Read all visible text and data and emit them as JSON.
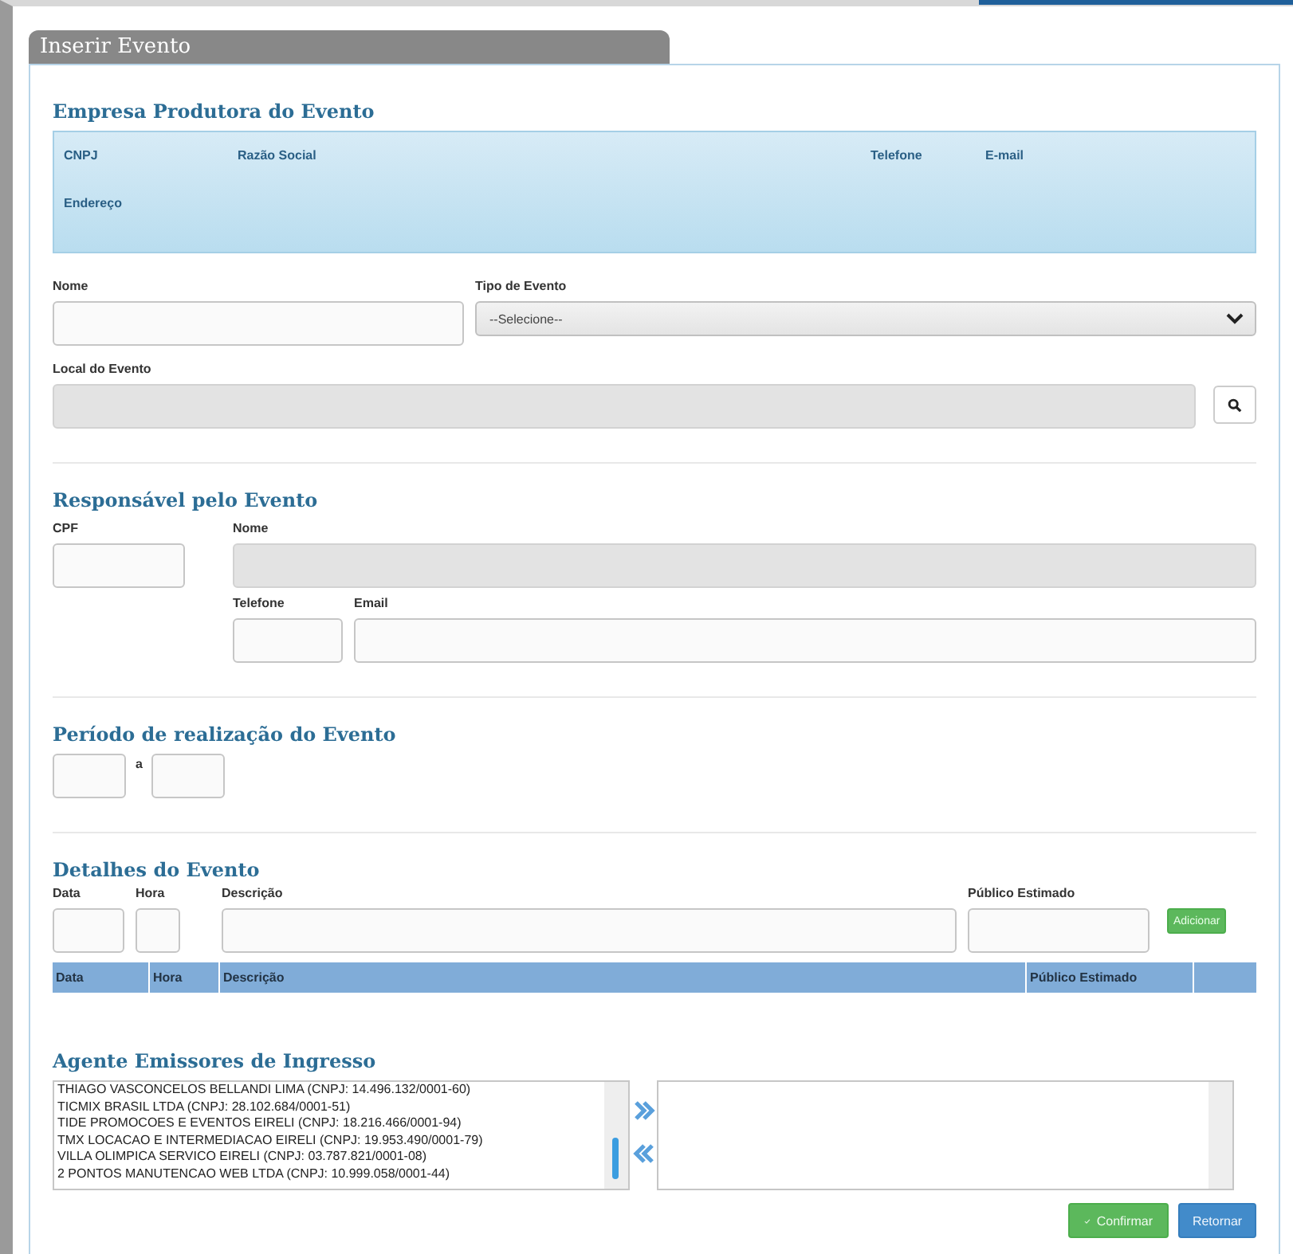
{
  "window": {
    "title": "Inserir Evento"
  },
  "company": {
    "heading": "Empresa Produtora do Evento",
    "labels": [
      "CNPJ",
      "Razão Social",
      "Telefone",
      "E-mail"
    ],
    "address_label": "Endereço"
  },
  "event": {
    "name": {
      "label": "Nome",
      "disabled": false
    },
    "type": {
      "label": "Tipo de Evento",
      "value": "--Selecione--"
    },
    "location": {
      "label": "Local do Evento",
      "disabled": true
    }
  },
  "responsible": {
    "heading": "Responsável pelo Evento",
    "fields": [
      {
        "label": "CPF",
        "disabled": false
      },
      {
        "label": "Nome",
        "disabled": true
      },
      {
        "label": "Telefone",
        "disabled": false
      },
      {
        "label": "Email",
        "disabled": false
      }
    ]
  },
  "period": {
    "heading": "Período de realização do Evento",
    "separator": "a"
  },
  "details": {
    "heading": "Detalhes do Evento",
    "labels": [
      "Data",
      "Hora",
      "Descrição",
      "Público Estimado"
    ],
    "add_button": "Adicionar",
    "columns": [
      "Data",
      "Hora",
      "Descrição",
      "Público Estimado"
    ]
  },
  "agents": {
    "heading": "Agente Emissores de Ingresso",
    "available": [
      "THIAGO VASCONCELOS BELLANDI LIMA (CNPJ: 14.496.132/0001-60)",
      "TICMIX BRASIL LTDA (CNPJ: 28.102.684/0001-51)",
      "TIDE PROMOCOES E EVENTOS EIRELI (CNPJ: 18.216.466/0001-94)",
      "TMX LOCACAO E INTERMEDIACAO EIRELI (CNPJ: 19.953.490/0001-79)",
      "VILLA OLIMPICA SERVICO EIRELI (CNPJ: 03.787.821/0001-08)",
      "2 PONTOS MANUTENCAO WEB LTDA (CNPJ: 10.999.058/0001-44)"
    ]
  },
  "buttons": {
    "confirm": "Confirmar",
    "back": "Retornar"
  }
}
